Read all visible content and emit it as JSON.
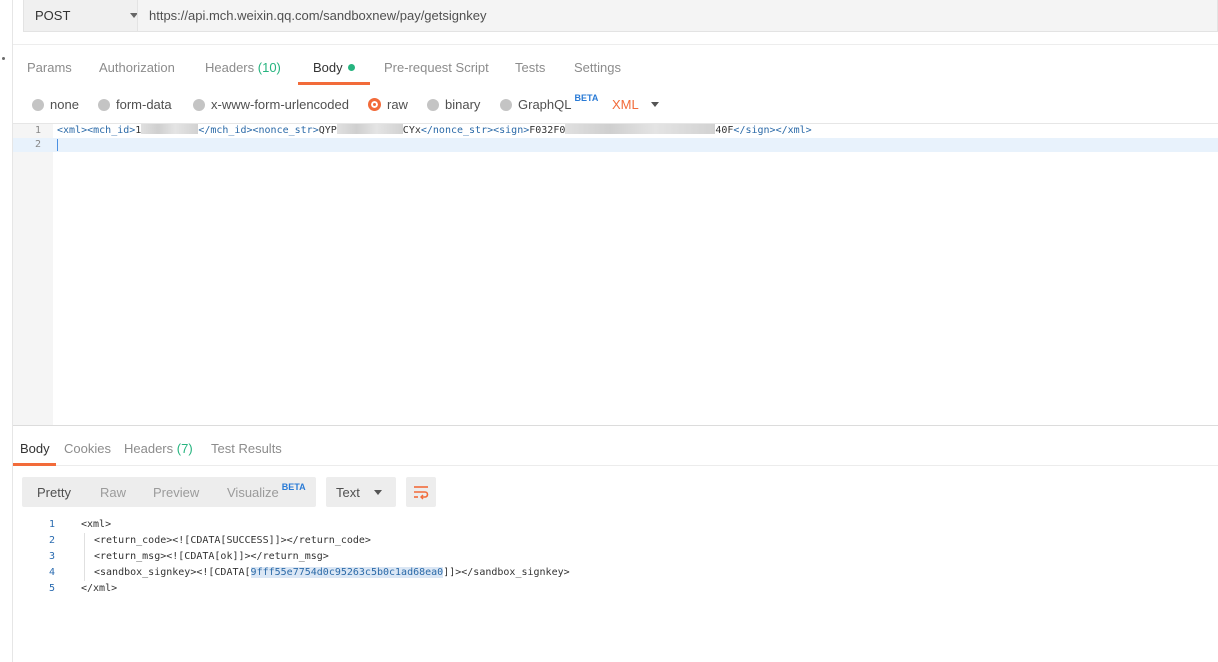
{
  "request": {
    "method": "POST",
    "url": "https://api.mch.weixin.qq.com/sandboxnew/pay/getsignkey"
  },
  "request_tabs": [
    {
      "label": "Params"
    },
    {
      "label": "Authorization"
    },
    {
      "label": "Headers",
      "count": "(10)"
    },
    {
      "label": "Body",
      "active": true
    },
    {
      "label": "Pre-request Script"
    },
    {
      "label": "Tests"
    },
    {
      "label": "Settings"
    }
  ],
  "body_types": {
    "none": "none",
    "form_data": "form-data",
    "urlencoded": "x-www-form-urlencoded",
    "raw": "raw",
    "binary": "binary",
    "graphql": "GraphQL",
    "graphql_badge": "BETA",
    "selected": "raw",
    "raw_format": "XML"
  },
  "editor": {
    "line_numbers": [
      "1",
      "2"
    ],
    "line1": {
      "xml_open": "<xml>",
      "mch_open": "<mch_id>",
      "mch_visible": "1",
      "mch_close": "</mch_id>",
      "nonce_open": "<nonce_str>",
      "nonce_start": "QYP",
      "nonce_end": "CYx",
      "nonce_close": "</nonce_str>",
      "sign_open": "<sign>",
      "sign_start": "F032F0",
      "sign_end": "40F",
      "sign_close": "</sign>",
      "xml_close": "</xml>"
    }
  },
  "response_tabs": [
    {
      "label": "Body",
      "active": true
    },
    {
      "label": "Cookies"
    },
    {
      "label": "Headers",
      "count": "(7)"
    },
    {
      "label": "Test Results"
    }
  ],
  "response_view": {
    "pretty": "Pretty",
    "raw": "Raw",
    "preview": "Preview",
    "visualize": "Visualize",
    "visualize_badge": "BETA",
    "format": "Text"
  },
  "response_body": {
    "line_numbers": [
      "1",
      "2",
      "3",
      "4",
      "5"
    ],
    "l1": "<xml>",
    "l2": "<return_code><![CDATA[SUCCESS]]></return_code>",
    "l3": "<return_msg><![CDATA[ok]]></return_msg>",
    "l4_pre": "<sandbox_signkey><![CDATA[",
    "l4_key": "9fff55e7754d0c95263c5b0c1ad68ea0",
    "l4_post": "]]></sandbox_signkey>",
    "l5": "</xml>"
  },
  "colors": {
    "accent": "#f26b3a",
    "green": "#26b47f",
    "beta_blue": "#2a7bd6"
  }
}
